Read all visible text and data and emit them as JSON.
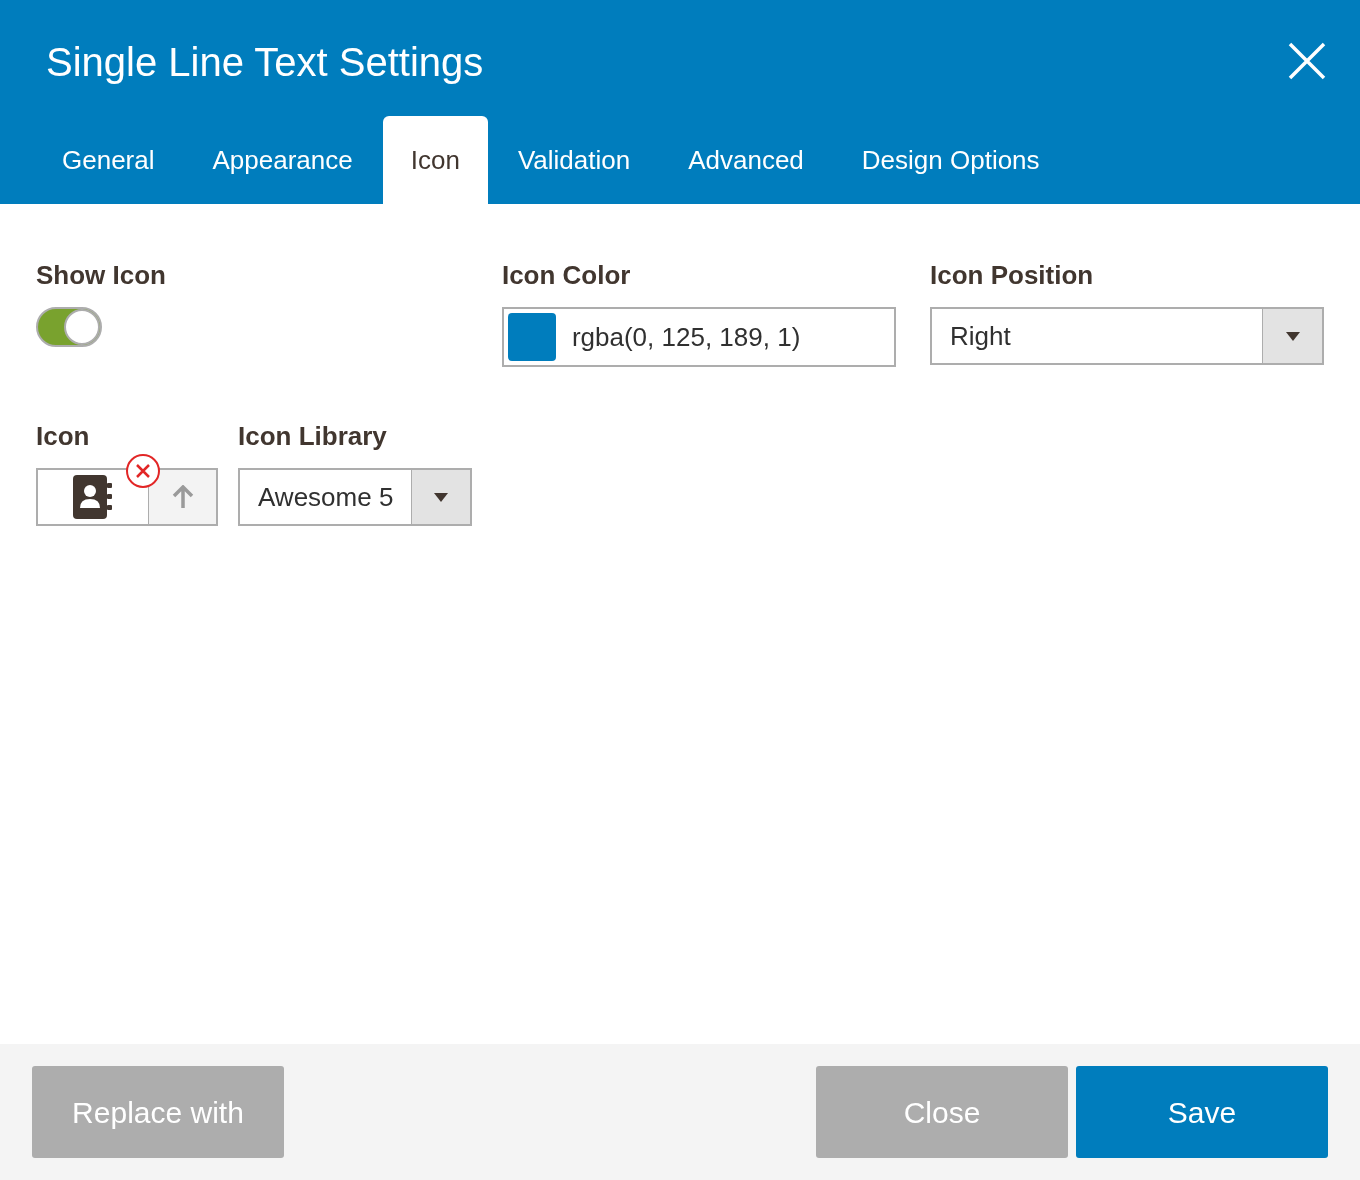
{
  "dialog": {
    "title": "Single Line Text Settings"
  },
  "tabs": [
    {
      "label": "General",
      "selected": false
    },
    {
      "label": "Appearance",
      "selected": false
    },
    {
      "label": "Icon",
      "selected": true
    },
    {
      "label": "Validation",
      "selected": false
    },
    {
      "label": "Advanced",
      "selected": false
    },
    {
      "label": "Design Options",
      "selected": false
    }
  ],
  "show_icon": {
    "label": "Show Icon",
    "on": true
  },
  "icon_color": {
    "label": "Icon Color",
    "value": "rgba(0, 125, 189, 1)"
  },
  "icon_position": {
    "label": "Icon Position",
    "value": "Right"
  },
  "icon": {
    "label": "Icon"
  },
  "icon_library": {
    "label": "Icon Library",
    "value": "Awesome 5"
  },
  "footer": {
    "buttons": [
      {
        "label": "Replace with",
        "kind": "secondary"
      },
      {
        "label": "Close",
        "kind": "secondary"
      },
      {
        "label": "Save",
        "kind": "primary"
      }
    ]
  }
}
